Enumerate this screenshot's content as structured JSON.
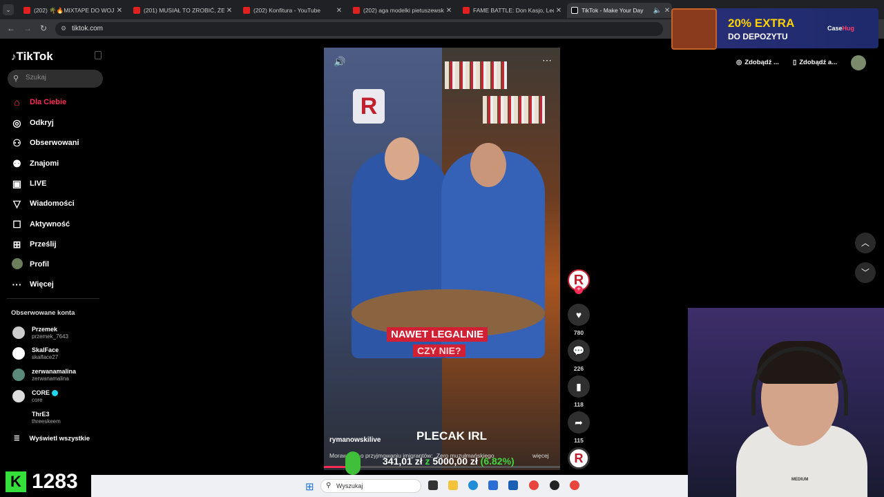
{
  "browser": {
    "tabs": [
      {
        "title": "(202) 🌴🔥MIXTAPE DO WOJ",
        "active": false
      },
      {
        "title": "(201) MUSIAŁ TO ZROBIĆ, ŻEBY",
        "active": false
      },
      {
        "title": "(202) Konfitura - YouTube",
        "active": false
      },
      {
        "title": "(202) aga modelki pietuszewsk",
        "active": false
      },
      {
        "title": "FAME BATTLE: Don Kasjo, Lequ",
        "active": false
      },
      {
        "title": "TikTok - Make Your Day",
        "active": true
      }
    ],
    "url": "tiktok.com"
  },
  "ad": {
    "headline": "20% EXTRA",
    "subline": "DO DEPOZYTU",
    "brand": "Case",
    "brand_accent": "Hug"
  },
  "sidebar": {
    "logo": "TikTok",
    "search_placeholder": "Szukaj",
    "nav": [
      {
        "label": "Dla Ciebie",
        "icon": "home-icon",
        "active": true
      },
      {
        "label": "Odkryj",
        "icon": "compass-icon"
      },
      {
        "label": "Obserwowani",
        "icon": "user-follow-icon"
      },
      {
        "label": "Znajomi",
        "icon": "friends-icon"
      },
      {
        "label": "LIVE",
        "icon": "live-icon"
      },
      {
        "label": "Wiadomości",
        "icon": "send-icon"
      },
      {
        "label": "Aktywność",
        "icon": "activity-icon"
      },
      {
        "label": "Prześlij",
        "icon": "upload-icon"
      },
      {
        "label": "Profil",
        "icon": "profile-avatar"
      },
      {
        "label": "Więcej",
        "icon": "more-icon"
      }
    ],
    "followed_header": "Obserwowane konta",
    "accounts": [
      {
        "name": "Przemek",
        "handle": "przemek_7643"
      },
      {
        "name": "SkalFace",
        "handle": "skalface27"
      },
      {
        "name": "zerwanamalina",
        "handle": "zerwanamalina"
      },
      {
        "name": "CORE",
        "handle": "core",
        "verified": true
      },
      {
        "name": "ThrE3",
        "handle": "threeskeem"
      }
    ],
    "show_all": "Wyświetl wszystkie"
  },
  "video": {
    "caption_line1": "NAWET LEGALNIE",
    "caption_line2": "CZY NIE?",
    "overlay_title": "PLECAK IRL",
    "author": "rymanowskilive",
    "description": "Morawiecki o przyjmowaniu imigrantów: „Zero muzułmańskiego",
    "more": "więcej",
    "progress": 0.12
  },
  "actions": {
    "likes": "780",
    "comments": "226",
    "saves": "118",
    "shares": "115"
  },
  "header_right": {
    "pill1": "Zdobądź ...",
    "pill2": "Zdobądź a..."
  },
  "overlay": {
    "amount": "341,01 zł",
    "z": "z",
    "goal": "5000,00 zł",
    "percent": "(6.82%)",
    "counter": "1283"
  },
  "taskbar": {
    "search": "Wyszukaj"
  },
  "webcam": {
    "shirt_text": "MEDIUM"
  },
  "colors": {
    "accent": "#fe2c55",
    "money_green": "#3fd83f"
  }
}
